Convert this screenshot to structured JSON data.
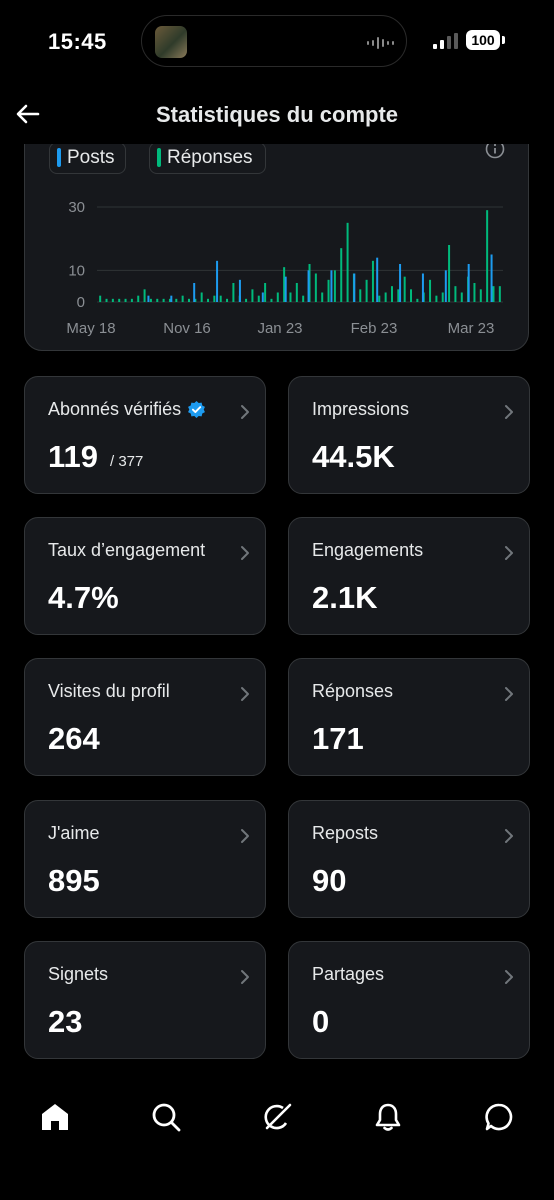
{
  "status": {
    "time": "15:45",
    "battery": "100"
  },
  "header": {
    "title": "Statistiques du compte"
  },
  "legend": [
    {
      "label": "Posts",
      "color": "#1d9bf0"
    },
    {
      "label": "Réponses",
      "color": "#00ba7c"
    }
  ],
  "chart_data": {
    "type": "bar",
    "title": "",
    "xlabel": "",
    "ylabel": "",
    "ylim": [
      0,
      30
    ],
    "yticks": [
      "30",
      "10",
      "0"
    ],
    "xticks": [
      "May 18",
      "Nov 16",
      "Jan 23",
      "Feb 23",
      "Mar 23"
    ],
    "grid": true,
    "series": [
      {
        "name": "Posts",
        "color": "#1d9bf0",
        "values": [
          2,
          2,
          6,
          13,
          7,
          3,
          8,
          10,
          10,
          9,
          14,
          12,
          9,
          10,
          12,
          15
        ]
      },
      {
        "name": "Réponses",
        "color": "#00ba7c",
        "values": [
          2,
          1,
          1,
          1,
          1,
          1,
          2,
          4,
          1,
          1,
          1,
          1,
          1,
          2,
          1,
          1,
          3,
          1,
          2,
          2,
          1,
          6,
          2,
          1,
          4,
          2,
          6,
          1,
          3,
          11,
          3,
          6,
          2,
          12,
          9,
          3,
          7,
          10,
          17,
          25,
          9,
          4,
          7,
          13,
          2,
          3,
          5,
          4,
          8,
          4,
          1,
          3,
          7,
          2,
          3,
          18,
          5,
          3,
          8,
          6,
          4,
          29,
          5,
          5
        ]
      }
    ]
  },
  "stats": [
    {
      "label": "Abonnés vérifiés",
      "value": "119",
      "sub": "/ 377",
      "verified": true,
      "verified_color": "#1d9bf0"
    },
    {
      "label": "Impressions",
      "value": "44.5K"
    },
    {
      "label": "Taux d’engagement",
      "value": "4.7%"
    },
    {
      "label": "Engagements",
      "value": "2.1K"
    },
    {
      "label": "Visites du profil",
      "value": "264"
    },
    {
      "label": "Réponses",
      "value": "171"
    },
    {
      "label": "J'aime",
      "value": "895"
    },
    {
      "label": "Reposts",
      "value": "90"
    },
    {
      "label": "Signets",
      "value": "23"
    },
    {
      "label": "Partages",
      "value": "0"
    }
  ],
  "nav": [
    {
      "icon": "home-icon",
      "active": true
    },
    {
      "icon": "search-icon"
    },
    {
      "icon": "grok-icon"
    },
    {
      "icon": "bell-icon"
    },
    {
      "icon": "messages-icon"
    }
  ]
}
